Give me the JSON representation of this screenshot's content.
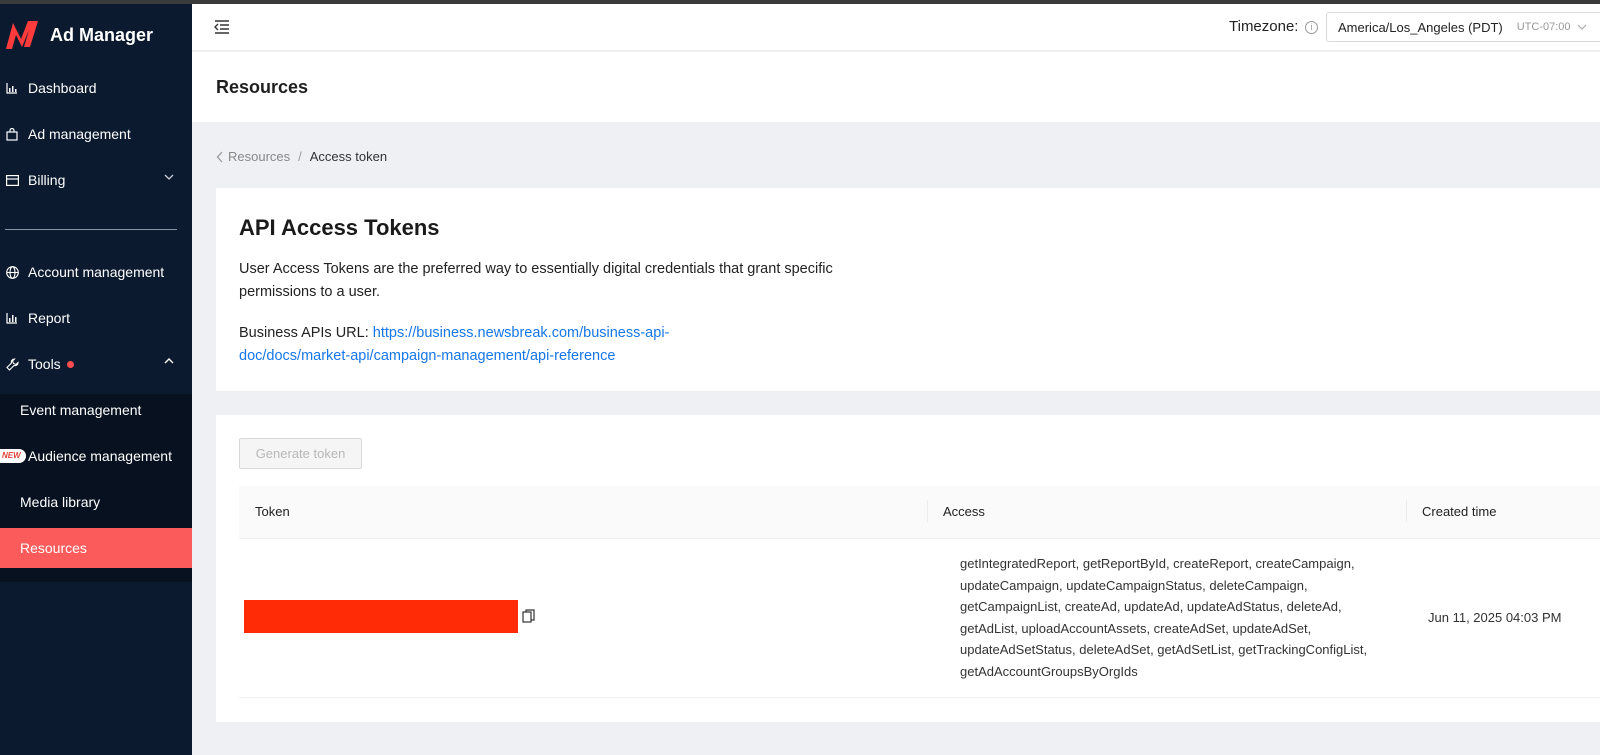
{
  "app": {
    "name": "Ad Manager"
  },
  "sidebar": {
    "items": [
      {
        "label": "Dashboard"
      },
      {
        "label": "Ad management"
      },
      {
        "label": "Billing"
      },
      {
        "label": "Account management"
      },
      {
        "label": "Report"
      },
      {
        "label": "Tools"
      }
    ],
    "tools_subitems": [
      {
        "label": "Event management"
      },
      {
        "label": "Audience management",
        "badge": "NEW"
      },
      {
        "label": "Media library"
      },
      {
        "label": "Resources",
        "active": true
      }
    ]
  },
  "header": {
    "timezone_label": "Timezone:",
    "timezone_value": "America/Los_Angeles (PDT)",
    "timezone_offset": "UTC-07:00"
  },
  "page": {
    "title": "Resources"
  },
  "breadcrumb": {
    "parent": "Resources",
    "separator": "/",
    "current": "Access token"
  },
  "info_card": {
    "title": "API Access Tokens",
    "description": "User Access Tokens are the preferred way to essentially digital credentials that grant specific permissions to a user.",
    "url_label": "Business APIs URL:",
    "url": "https://business.newsbreak.com/business-api-doc/docs/market-api/campaign-management/api-reference"
  },
  "token_card": {
    "generate_button": "Generate token",
    "columns": [
      "Token",
      "Access",
      "Created time"
    ],
    "rows": [
      {
        "access": "getIntegratedReport, getReportById, createReport, createCampaign, updateCampaign, updateCampaignStatus, deleteCampaign, getCampaignList, createAd, updateAd, updateAdStatus, deleteAd, getAdList, uploadAccountAssets, createAdSet, updateAdSet, updateAdSetStatus, deleteAdSet, getAdSetList, getTrackingConfigList, getAdAccountGroupsByOrgIds",
        "created": "Jun 11, 2025 04:03 PM"
      }
    ]
  },
  "colors": {
    "sidebar_bg": "#0b1a2e",
    "active_item": "#fb5b5b",
    "link": "#1677e8",
    "redaction": "#ff2a06"
  }
}
